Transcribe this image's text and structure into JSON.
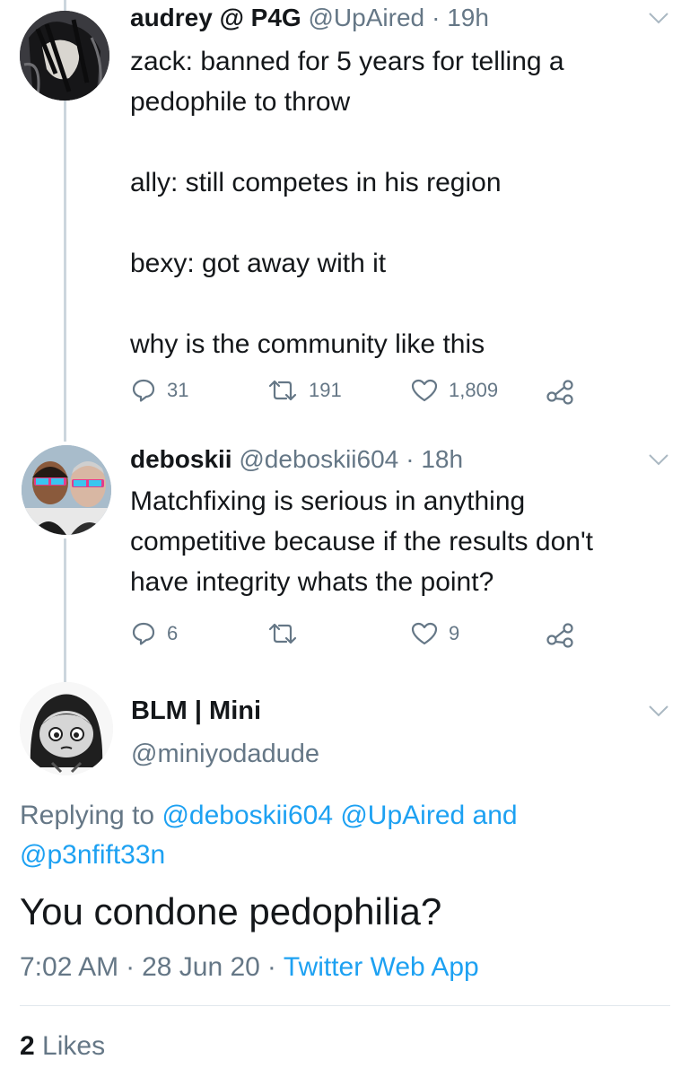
{
  "tweets": [
    {
      "display_name": "audrey @ P4G",
      "handle": "@UpAired",
      "time": "19h",
      "text_lines": [
        "zack: banned for 5 years for telling a",
        "pedophile to throw",
        "",
        "ally: still competes in his region",
        "",
        "bexy: got away with it",
        "",
        "why is the community like this"
      ],
      "replies": "31",
      "retweets": "191",
      "likes": "1,809"
    },
    {
      "display_name": "deboskii",
      "handle": "@deboskii604",
      "time": "18h",
      "text_lines": [
        "Matchfixing is serious in anything",
        "competitive because if the results don't",
        "have integrity whats the point?"
      ],
      "replies": "6",
      "retweets": "",
      "likes": "9"
    }
  ],
  "focused_tweet": {
    "display_name": "BLM | Mini",
    "handle": "@miniyodadude",
    "replying_prefix": "Replying to",
    "replying_users_line1": "@deboskii604 @UpAired and",
    "replying_users_line2": "@p3nfift33n",
    "text": "You condone pedophilia?",
    "time": "7:02 AM",
    "date": "28 Jun 20",
    "source": "Twitter Web App",
    "likes_count": "2",
    "likes_label": "Likes"
  },
  "separator": "·",
  "icons": {
    "reply": "reply-icon",
    "retweet": "retweet-icon",
    "like": "heart-icon",
    "share": "share-icon",
    "more": "chevron-down-icon"
  },
  "colors": {
    "text": "#14171a",
    "muted": "#657786",
    "link": "#1da1f2",
    "thread_line": "#ccd6dd"
  }
}
